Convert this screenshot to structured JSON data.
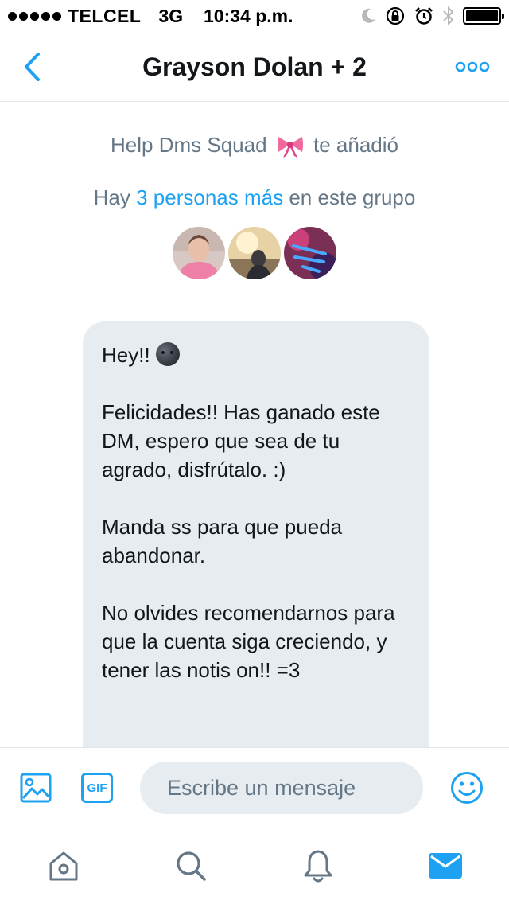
{
  "status_bar": {
    "carrier": "TELCEL",
    "network": "3G",
    "time": "10:34 p.m.",
    "battery_level": 1.0
  },
  "header": {
    "title": "Grayson Dolan + 2"
  },
  "conversation": {
    "added_by": "Help Dms Squad",
    "added_by_emoji": "ribbon",
    "added_suffix": "te añadió",
    "group_prefix": "Hay",
    "group_link": "3 personas más",
    "group_suffix": "en este grupo",
    "avatars": [
      {
        "icon": "avatar-person-pink-hoodie"
      },
      {
        "icon": "avatar-person-sunset"
      },
      {
        "icon": "avatar-help-dms-squad-logo"
      }
    ],
    "message": {
      "line1": "Hey!!",
      "line1_emoji": "new-moon-face",
      "para1": "Felicidades!! Has ganado este DM, espero que sea de tu agrado, disfrútalo. :)",
      "para2": "Manda ss para que pueda abandonar.",
      "para3": "No olvides recomendarnos para que la cuenta siga creciendo, y tener las notis on!! =3"
    }
  },
  "composer": {
    "gif_label": "GIF",
    "placeholder": "Escribe un mensaje"
  },
  "colors": {
    "accent": "#1da1f2",
    "bubble": "#e6ecf0",
    "muted_text": "#657786",
    "divider": "#e1e8ed"
  }
}
